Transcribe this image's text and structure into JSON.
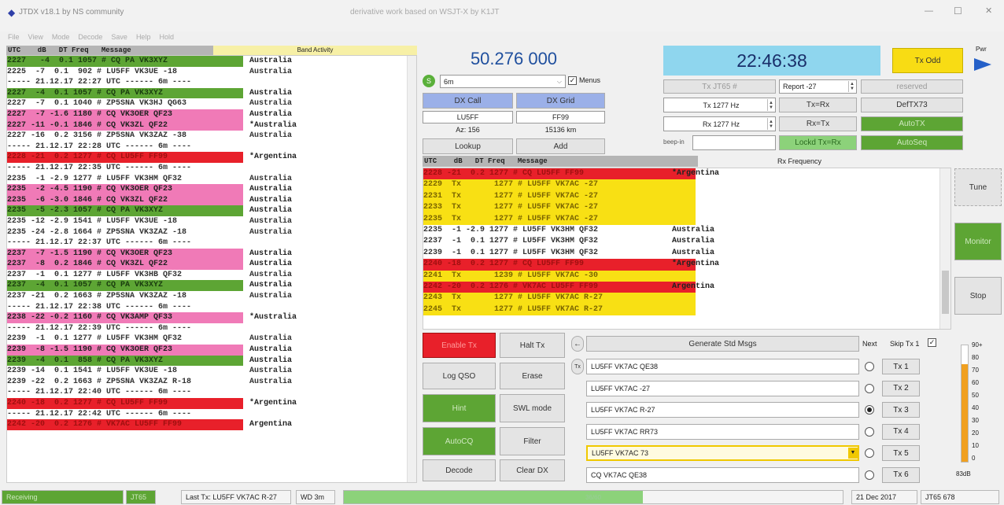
{
  "titlebar": {
    "title": "JTDX v18.1 by NS community",
    "subtitle": "derivative work based on WSJT-X by K1JT",
    "min": "—",
    "max": "☐",
    "close": "✕"
  },
  "menu": [
    "File",
    "View",
    "Mode",
    "Decode",
    "Save",
    "Help",
    "Hold"
  ],
  "band_header": {
    "cols": "UTC    dB   DT Freq   Message",
    "title": "Band Activity"
  },
  "band_rows": [
    {
      "t": "2227   -4  0.1 1057 # CQ PA VK3XYZ",
      "c": "Australia",
      "bg": "#5da534",
      "fg": "#1a3d0f"
    },
    {
      "t": "2225  -7  0.1  902 # LU5FF VK3UE -18",
      "c": "Australia",
      "bg": "#ffffff",
      "fg": "#333333"
    },
    {
      "t": "----- 21.12.17 22:27 UTC ------ 6m ----",
      "c": "",
      "bg": "#ffffff",
      "fg": "#333333"
    },
    {
      "t": "2227  -4  0.1 1057 # CQ PA VK3XYZ",
      "c": "Australia",
      "bg": "#5da534",
      "fg": "#1a3d0f"
    },
    {
      "t": "2227  -7  0.1 1040 # ZP5SNA VK3HJ QG63",
      "c": "Australia",
      "bg": "#ffffff",
      "fg": "#333333"
    },
    {
      "t": "2227  -7 -1.6 1180 # CQ VK3OER QF23",
      "c": "Australia",
      "bg": "#f07ab7",
      "fg": "#222222"
    },
    {
      "t": "2227 -11 -0.1 1846 # CQ VK3ZL QF22",
      "c": "*Australia",
      "bg": "#f07ab7",
      "fg": "#222222"
    },
    {
      "t": "2227 -16  0.2 3156 # ZP5SNA VK3ZAZ -38",
      "c": "Australia",
      "bg": "#ffffff",
      "fg": "#333333"
    },
    {
      "t": "----- 21.12.17 22:28 UTC ------ 6m ----",
      "c": "",
      "bg": "#ffffff",
      "fg": "#333333"
    },
    {
      "t": "2228 -21  0.2 1277 # CQ LU5FF FF99",
      "c": "*Argentina",
      "bg": "#e8202a",
      "fg": "#a01010"
    },
    {
      "t": "----- 21.12.17 22:35 UTC ------ 6m ----",
      "c": "",
      "bg": "#ffffff",
      "fg": "#333333"
    },
    {
      "t": "2235  -1 -2.9 1277 # LU5FF VK3HM QF32",
      "c": "Australia",
      "bg": "#ffffff",
      "fg": "#333333"
    },
    {
      "t": "2235  -2 -4.5 1190 # CQ VK3OER QF23",
      "c": "Australia",
      "bg": "#f07ab7",
      "fg": "#222222"
    },
    {
      "t": "2235  -6 -3.0 1846 # CQ VK3ZL QF22",
      "c": "Australia",
      "bg": "#f07ab7",
      "fg": "#222222"
    },
    {
      "t": "2235  -5 -2.3 1057 # CQ PA VK3XYZ",
      "c": "Australia",
      "bg": "#5da534",
      "fg": "#1a3d0f"
    },
    {
      "t": "2235 -12 -2.9 1541 # LU5FF VK3UE -18",
      "c": "Australia",
      "bg": "#ffffff",
      "fg": "#333333"
    },
    {
      "t": "2235 -24 -2.8 1664 # ZP5SNA VK3ZAZ -18",
      "c": "Australia",
      "bg": "#ffffff",
      "fg": "#333333"
    },
    {
      "t": "----- 21.12.17 22:37 UTC ------ 6m ----",
      "c": "",
      "bg": "#ffffff",
      "fg": "#333333"
    },
    {
      "t": "2237  -7 -1.5 1190 # CQ VK3OER QF23",
      "c": "Australia",
      "bg": "#f07ab7",
      "fg": "#222222"
    },
    {
      "t": "2237  -8  0.2 1846 # CQ VK3ZL QF22",
      "c": "Australia",
      "bg": "#f07ab7",
      "fg": "#222222"
    },
    {
      "t": "2237  -1  0.1 1277 # LU5FF VK3HB QF32",
      "c": "Australia",
      "bg": "#ffffff",
      "fg": "#333333"
    },
    {
      "t": "2237  -4  0.1 1057 # CQ PA VK3XYZ",
      "c": "Australia",
      "bg": "#5da534",
      "fg": "#1a3d0f"
    },
    {
      "t": "2237 -21  0.2 1663 # ZP5SNA VK3ZAZ -18",
      "c": "Australia",
      "bg": "#ffffff",
      "fg": "#333333"
    },
    {
      "t": "----- 21.12.17 22:38 UTC ------ 6m ----",
      "c": "",
      "bg": "#ffffff",
      "fg": "#333333"
    },
    {
      "t": "2238 -22 -0.2 1160 # CQ VK3AMP QF33",
      "c": "*Australia",
      "bg": "#f07ab7",
      "fg": "#222222"
    },
    {
      "t": "----- 21.12.17 22:39 UTC ------ 6m ----",
      "c": "",
      "bg": "#ffffff",
      "fg": "#333333"
    },
    {
      "t": "2239  -1  0.1 1277 # LU5FF VK3HM QF32",
      "c": "Australia",
      "bg": "#ffffff",
      "fg": "#333333"
    },
    {
      "t": "2239  -8 -1.5 1190 # CQ VK3OER QF23",
      "c": "Australia",
      "bg": "#f07ab7",
      "fg": "#222222"
    },
    {
      "t": "2239  -4  0.1  858 # CQ PA VK3XYZ",
      "c": "Australia",
      "bg": "#5da534",
      "fg": "#1a3d0f"
    },
    {
      "t": "2239 -14  0.1 1541 # LU5FF VK3UE -18",
      "c": "Australia",
      "bg": "#ffffff",
      "fg": "#333333"
    },
    {
      "t": "2239 -22  0.2 1663 # ZP5SNA VK3ZAZ R-18",
      "c": "Australia",
      "bg": "#ffffff",
      "fg": "#333333"
    },
    {
      "t": "----- 21.12.17 22:40 UTC ------ 6m ----",
      "c": "",
      "bg": "#ffffff",
      "fg": "#333333"
    },
    {
      "t": "2240 -18  0.2 1277 # CQ LU5FF FF99",
      "c": "*Argentina",
      "bg": "#e8202a",
      "fg": "#a01010"
    },
    {
      "t": "----- 21.12.17 22:42 UTC ------ 6m ----",
      "c": "",
      "bg": "#ffffff",
      "fg": "#333333"
    },
    {
      "t": "2242 -20  0.2 1276 # VK7AC LU5FF FF99",
      "c": "Argentina",
      "bg": "#e8202a",
      "fg": "#a01010"
    }
  ],
  "freq": {
    "dial": "50.276 000",
    "band": "6m",
    "menus_label": "Menus",
    "menus_checked": true
  },
  "dx": {
    "dx_call_btn": "DX Call",
    "dx_grid_btn": "DX Grid",
    "call": "LU5FF",
    "grid": "FF99",
    "az": "Az: 156",
    "dist": "15136 km",
    "lookup": "Lookup",
    "add": "Add"
  },
  "clock": {
    "time": "22:46:38",
    "tx_odd": "Tx Odd"
  },
  "ctrl": {
    "tx_jt65": "Tx JT65 #",
    "report": "Report -27",
    "reserved": "reserved",
    "tx_hz": "Tx 1277 Hz",
    "tx_eq_rx": "Tx=Rx",
    "defsm": "DefTX73",
    "rx_hz": "Rx 1277 Hz",
    "rx_eq_tx": "Rx=Tx",
    "auto_seq": "AutoTX",
    "beep_label": "beep-in",
    "lock": "Lockd Tx=Rx",
    "autoseq2": "AutoSeq"
  },
  "rx_title": "Rx Frequency",
  "rx_header": "UTC    dB   DT Freq   Message",
  "rx_rows": [
    {
      "t": "2228 -21  0.2 1277 # CQ LU5FF FF99",
      "c": "*Argentina",
      "bg": "#e8202a",
      "fg": "#a01010",
      "w": 346
    },
    {
      "t": "2229  Tx       1277 # LU5FF VK7AC -27",
      "c": "",
      "bg": "#f8e014",
      "fg": "#7a6400",
      "w": 346
    },
    {
      "t": "2231  Tx       1277 # LU5FF VK7AC -27",
      "c": "",
      "bg": "#f8e014",
      "fg": "#7a6400",
      "w": 346
    },
    {
      "t": "2233  Tx       1277 # LU5FF VK7AC -27",
      "c": "",
      "bg": "#f8e014",
      "fg": "#7a6400",
      "w": 346
    },
    {
      "t": "2235  Tx       1277 # LU5FF VK7AC -27",
      "c": "",
      "bg": "#f8e014",
      "fg": "#7a6400",
      "w": 346
    },
    {
      "t": "2235  -1 -2.9 1277 # LU5FF VK3HM QF32",
      "c": "Australia",
      "bg": "#ffffff",
      "fg": "#333333",
      "w": 0
    },
    {
      "t": "2237  -1  0.1 1277 # LU5FF VK3HM QF32",
      "c": "Australia",
      "bg": "#ffffff",
      "fg": "#333333",
      "w": 0
    },
    {
      "t": "2239  -1  0.1 1277 # LU5FF VK3HM QF32",
      "c": "Australia",
      "bg": "#ffffff",
      "fg": "#333333",
      "w": 0
    },
    {
      "t": "2240 -18  0.2 1277 # CQ LU5FF FF99",
      "c": "*Argentina",
      "bg": "#e8202a",
      "fg": "#a01010",
      "w": 346
    },
    {
      "t": "2241  Tx       1239 # LU5FF VK7AC -30",
      "c": "",
      "bg": "#f8e014",
      "fg": "#7a6400",
      "w": 346
    },
    {
      "t": "2242 -20  0.2 1276 # VK7AC LU5FF FF99",
      "c": "Argentina",
      "bg": "#e8202a",
      "fg": "#a01010",
      "w": 346
    },
    {
      "t": "2243  Tx       1277 # LU5FF VK7AC R-27",
      "c": "",
      "bg": "#f8e014",
      "fg": "#7a6400",
      "w": 346
    },
    {
      "t": "2245  Tx       1277 # LU5FF VK7AC R-27",
      "c": "",
      "bg": "#f8e014",
      "fg": "#7a6400",
      "w": 346
    }
  ],
  "right_btns": {
    "tune": "Tune",
    "monitor": "Monitor",
    "stop": "Stop"
  },
  "pwr": "Pwr",
  "bottom": {
    "enable_tx": "Enable Tx",
    "halt": "Halt Tx",
    "log": "Log QSO",
    "erase": "Erase",
    "hint": "Hint",
    "swl": "SWL mode",
    "auto": "AutoCQ",
    "filter": "Filter",
    "decode": "Decode",
    "clear_dx": "Clear DX"
  },
  "gen": {
    "label": "Generate Std Msgs",
    "next": "Next",
    "skip": "Skip Tx 1",
    "skip_checked": true,
    "msgs": [
      "LU5FF VK7AC QE38",
      "LU5FF VK7AC -27",
      "LU5FF VK7AC R-27",
      "LU5FF VK7AC RR73",
      "LU5FF VK7AC 73",
      "CQ VK7AC QE38"
    ],
    "tx": [
      "Tx 1",
      "Tx 2",
      "Tx 3",
      "Tx 4",
      "Tx 5",
      "Tx 6"
    ],
    "selected": 2
  },
  "meter": {
    "labels": [
      "90+",
      "80",
      "70",
      "60",
      "50",
      "40",
      "30",
      "20",
      "10",
      "0"
    ],
    "db": "83dB",
    "level": 0.83
  },
  "status": {
    "mode_state": "Receiving",
    "mode": "JT65",
    "last_tx": "Last Tx: LU5FF VK7AC R-27",
    "wd": "WD 3m",
    "progress_label": "36/60",
    "progress": 0.6,
    "date": "21 Dec 2017",
    "jt": "JT65 678"
  }
}
